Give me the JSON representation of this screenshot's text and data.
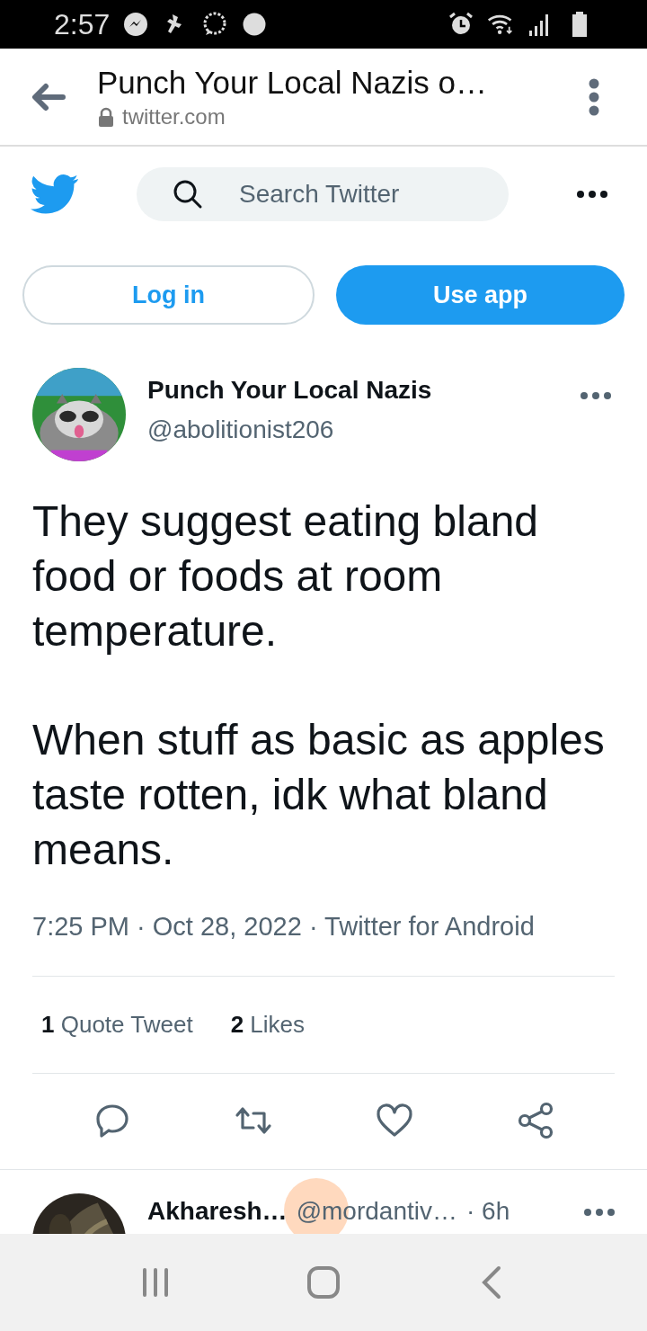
{
  "status_bar": {
    "time": "2:57"
  },
  "browser": {
    "title": "Punch Your Local Nazis o…",
    "url": "twitter.com"
  },
  "header": {
    "search": {
      "placeholder": "Search Twitter"
    }
  },
  "buttons": [
    {
      "label": "Log in",
      "kind": "outline"
    },
    {
      "label": "Use app",
      "kind": "primary"
    }
  ],
  "tweet": {
    "name": "Punch Your Local Nazis",
    "handle": "@abolitionist206",
    "paragraphs": [
      "They suggest eating bland food or foods at room temperature.",
      "When stuff as basic as apples taste rotten, idk what bland means."
    ],
    "meta": "7:25 PM · Oct 28, 2022 · Twitter for Android",
    "stats": [
      {
        "count": "1",
        "label": "Quote Tweet"
      },
      {
        "count": "2",
        "label": "Likes"
      }
    ]
  },
  "reply": {
    "name": "Akharesh…",
    "handle": "@mordantiv…",
    "time": "· 6h"
  }
}
